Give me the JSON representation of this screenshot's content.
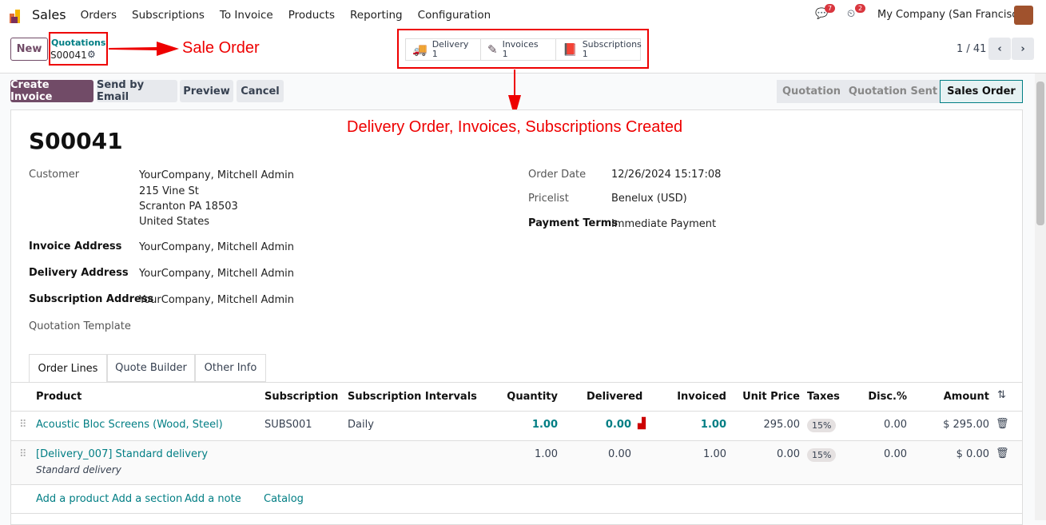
{
  "nav": {
    "app": "Sales",
    "menu": [
      "Orders",
      "Subscriptions",
      "To Invoice",
      "Products",
      "Reporting",
      "Configuration"
    ],
    "messages_count": "7",
    "activities_count": "2",
    "company": "My Company (San Francisco)"
  },
  "control": {
    "new_label": "New",
    "breadcrumb_parent": "Quotations",
    "record": "S00041",
    "pager": "1 / 41"
  },
  "smart_buttons": [
    {
      "label": "Delivery",
      "count": "1",
      "icon": "truck-icon"
    },
    {
      "label": "Invoices",
      "count": "1",
      "icon": "edit-icon"
    },
    {
      "label": "Subscriptions",
      "count": "1",
      "icon": "book-icon"
    }
  ],
  "annotations": {
    "sale_order": "Sale Order",
    "created": "Delivery Order, Invoices, Subscriptions Created"
  },
  "actions": [
    "Create Invoice",
    "Send by Email",
    "Preview",
    "Cancel"
  ],
  "status": {
    "steps": [
      "Quotation",
      "Quotation Sent",
      "Sales Order"
    ],
    "active": "Sales Order"
  },
  "form": {
    "title": "S00041",
    "customer_label": "Customer",
    "customer": "YourCompany, Mitchell Admin",
    "address": [
      "215 Vine St",
      "Scranton PA 18503",
      "United States"
    ],
    "invoice_address_label": "Invoice Address",
    "invoice_address": "YourCompany, Mitchell Admin",
    "delivery_address_label": "Delivery Address",
    "delivery_address": "YourCompany, Mitchell Admin",
    "subscription_address_label": "Subscription Address",
    "subscription_address": "YourCompany, Mitchell Admin",
    "template_label": "Quotation Template",
    "order_date_label": "Order Date",
    "order_date": "12/26/2024 15:17:08",
    "pricelist_label": "Pricelist",
    "pricelist": "Benelux (USD)",
    "payment_terms_label": "Payment Terms",
    "payment_terms": "Immediate Payment"
  },
  "tabs": [
    "Order Lines",
    "Quote Builder",
    "Other Info"
  ],
  "table": {
    "headers": [
      "Product",
      "Subscription",
      "Subscription Intervals",
      "Quantity",
      "Delivered",
      "Invoiced",
      "Unit Price",
      "Taxes",
      "Disc.%",
      "Amount"
    ],
    "rows": [
      {
        "product": "Acoustic Bloc Screens (Wood, Steel)",
        "subscription": "SUBS001",
        "interval": "Daily",
        "quantity": "1.00",
        "delivered": "0.00",
        "invoiced": "1.00",
        "unit_price": "295.00",
        "taxes": "15%",
        "disc": "0.00",
        "amount": "$ 295.00",
        "description": ""
      },
      {
        "product": "[Delivery_007] Standard delivery",
        "subscription": "",
        "interval": "",
        "quantity": "1.00",
        "delivered": "0.00",
        "invoiced": "1.00",
        "unit_price": "0.00",
        "taxes": "15%",
        "disc": "0.00",
        "amount": "$ 0.00",
        "description": "Standard delivery"
      }
    ],
    "add_links": [
      "Add a product",
      "Add a section",
      "Add a note",
      "Catalog"
    ]
  }
}
